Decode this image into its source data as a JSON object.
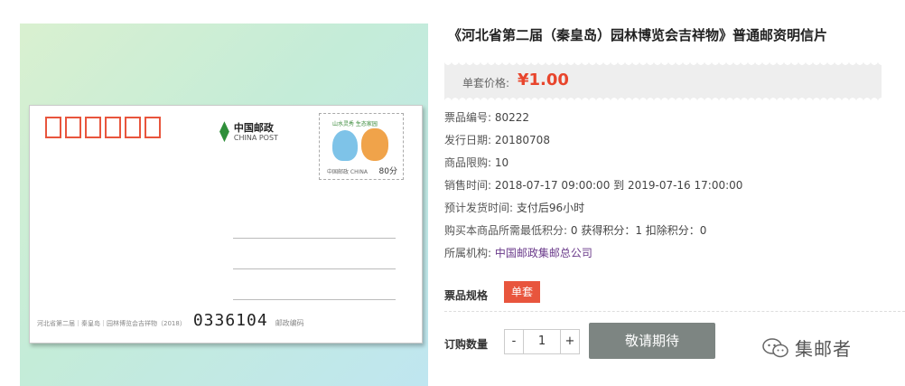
{
  "product_image": {
    "logo_cn": "中国邮政",
    "logo_en": "CHINA POST",
    "stamp_top": "山水灵秀 生态家园",
    "stamp_country": "中国邮政 CHINA",
    "stamp_value": "80分",
    "card_caption": "河北省第二届｜秦皇岛｜园林博览会吉祥物（2018）",
    "card_number": "0336104",
    "card_number_label": "邮政编码",
    "zip_box_count": 6
  },
  "title": "《河北省第二届（秦皇岛）园林博览会吉祥物》普通邮资明信片",
  "price": {
    "label": "单套价格:",
    "value": "¥1.00"
  },
  "info": [
    {
      "key": "票品编号:",
      "value": "80222"
    },
    {
      "key": "发行日期:",
      "value": "20180708"
    },
    {
      "key": "商品限购:",
      "value": "10"
    },
    {
      "key": "销售时间:",
      "value": "2018-07-17 09:00:00 到 2019-07-16 17:00:00"
    },
    {
      "key": "预计发货时间:",
      "value": "支付后96小时"
    },
    {
      "key": "购买本商品所需最低积分:",
      "value": "0 获得积分：1 扣除积分：0"
    },
    {
      "key": "所属机构:",
      "value": "中国邮政集邮总公司"
    }
  ],
  "spec": {
    "label": "票品规格",
    "option": "单套"
  },
  "quantity": {
    "label": "订购数量",
    "minus": "-",
    "value": "1",
    "plus": "+"
  },
  "action_button": "敬请期待",
  "watermark": "集邮者",
  "colors": {
    "accent": "#e8553d",
    "price": "#e8452c",
    "button": "#7d8582"
  }
}
